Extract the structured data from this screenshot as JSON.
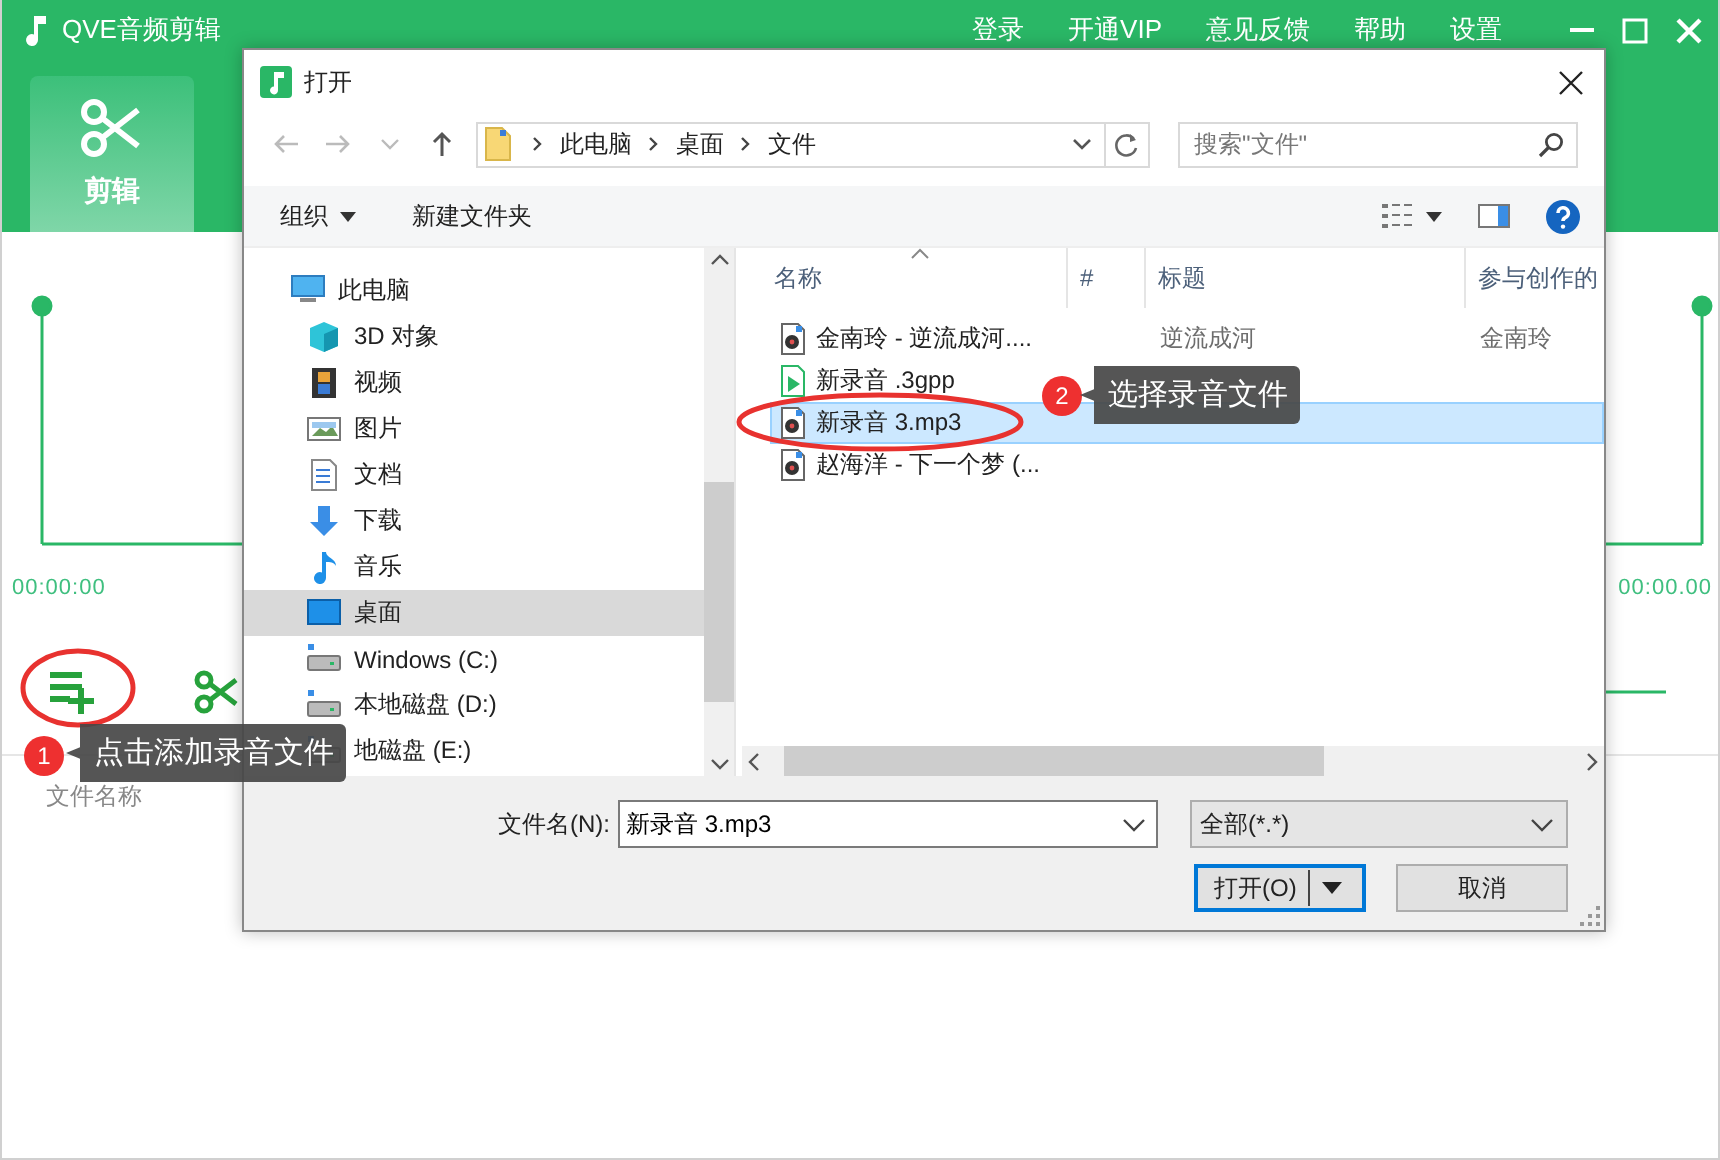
{
  "app": {
    "title": "QVE音频剪辑",
    "menu": [
      "登录",
      "开通VIP",
      "意见反馈",
      "帮助",
      "设置"
    ],
    "tabs": [
      {
        "label": "剪辑",
        "selected": true
      }
    ],
    "time_start": "00:00:00",
    "time_end": "00:00.00",
    "file_list_header": "文件名称"
  },
  "dialog": {
    "title": "打开",
    "breadcrumb": [
      "此电脑",
      "桌面",
      "文件"
    ],
    "search": {
      "placeholder": "搜索\"文件\""
    },
    "toolbar": {
      "organize": "组织",
      "new_folder": "新建文件夹"
    },
    "nav": [
      {
        "label": "此电脑",
        "kind": "pc",
        "selected": false,
        "children": [
          {
            "label": "3D 对象",
            "kind": "cube",
            "selected": false
          },
          {
            "label": "视频",
            "kind": "film",
            "selected": false
          },
          {
            "label": "图片",
            "kind": "image",
            "selected": false
          },
          {
            "label": "文档",
            "kind": "doc",
            "selected": false
          },
          {
            "label": "下载",
            "kind": "download",
            "selected": false
          },
          {
            "label": "音乐",
            "kind": "music",
            "selected": false
          },
          {
            "label": "桌面",
            "kind": "desktop",
            "selected": true
          },
          {
            "label": "Windows (C:)",
            "kind": "drive",
            "selected": false
          },
          {
            "label": "本地磁盘 (D:)",
            "kind": "drive",
            "selected": false
          },
          {
            "label": "地磁盘 (E:)",
            "kind": "drive",
            "selected": false
          }
        ]
      }
    ],
    "columns": [
      "名称",
      "#",
      "标题",
      "参与创作的"
    ],
    "files": [
      {
        "name": "金南玲 - 逆流成河....",
        "kind": "audio",
        "title": "逆流成河",
        "artist": "金南玲",
        "selected": false
      },
      {
        "name": "新录音 .3gpp",
        "kind": "video",
        "selected": false
      },
      {
        "name": "新录音 3.mp3",
        "kind": "audio",
        "selected": true
      },
      {
        "name": "赵海洋 - 下一个梦 (...",
        "kind": "audio",
        "selected": false
      }
    ],
    "filename_label": "文件名(N):",
    "filename": "新录音 3.mp3",
    "filter": "全部(*.*)",
    "buttons": [
      {
        "label": "打开(O)",
        "kind": "split"
      },
      {
        "label": "取消",
        "kind": "plain"
      }
    ]
  },
  "annotations": [
    {
      "number": "1",
      "text": "点击添加录音文件"
    },
    {
      "number": "2",
      "text": "选择录音文件"
    }
  ]
}
